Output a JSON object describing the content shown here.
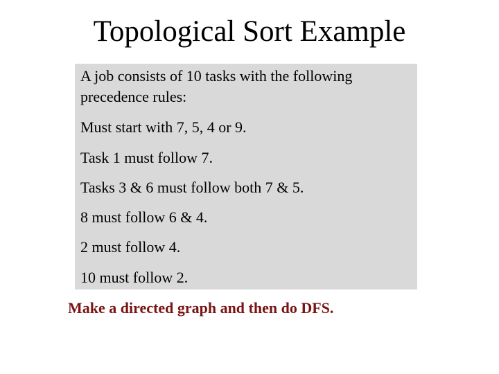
{
  "slide": {
    "title": "Topological Sort Example",
    "intro_lines": [
      "A job consists of 10 tasks with the following",
      "precedence rules:"
    ],
    "rules": [
      "Must start with 7, 5, 4 or 9.",
      "Task 1 must follow 7.",
      "Tasks 3 & 6 must follow both 7 & 5.",
      "8 must follow 6 & 4.",
      "2 must follow 4.",
      "10 must follow 2."
    ],
    "footer": "Make a directed graph and then do DFS.",
    "colors": {
      "box_background": "#d9d9d9",
      "footer_text": "#7a1414"
    }
  }
}
